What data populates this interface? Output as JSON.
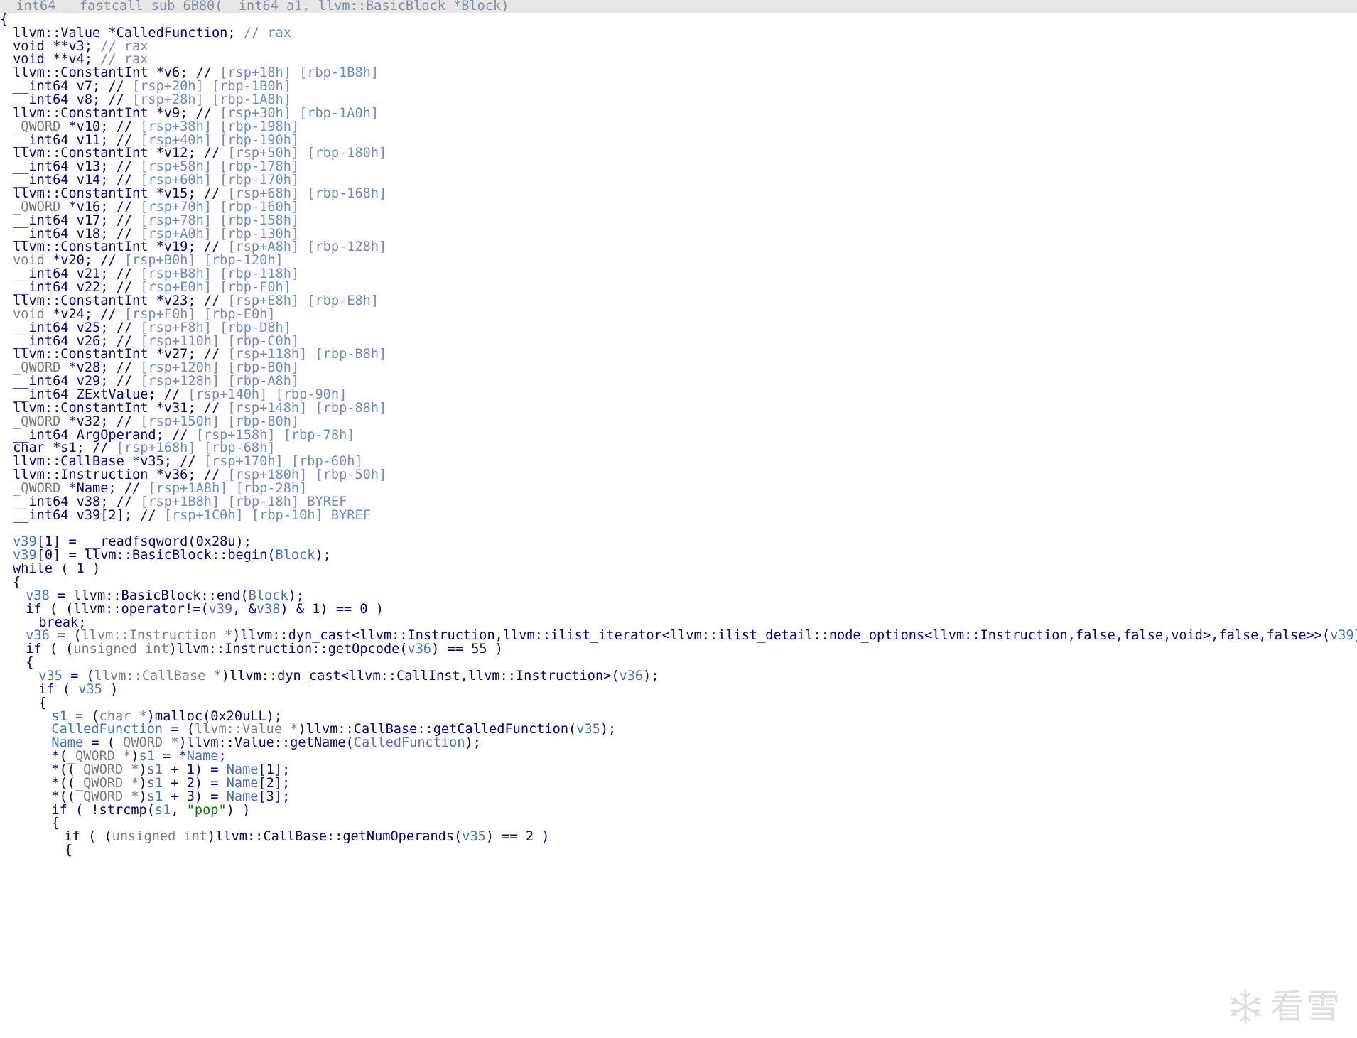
{
  "colors": {
    "background": "#ffffff",
    "header_bar": "#e6e6e6",
    "code": "#000080",
    "variable": "#4a6fbf",
    "type": "#7a7a7a",
    "comment": "#6f88c8",
    "string": "#007a00"
  },
  "watermark": {
    "logo_icon": "snowflake-icon",
    "text": "看雪"
  },
  "lines": [
    {
      "indent": 0,
      "header": true,
      "tokens": [
        {
          "t": "__int64 __fastcall sub_6B80(__int64 a1, llvm::BasicBlock *Block)",
          "c": "g"
        }
      ]
    },
    {
      "indent": 0,
      "tokens": [
        {
          "t": "{",
          "c": "c"
        }
      ]
    },
    {
      "indent": 1,
      "tokens": [
        {
          "t": "llvm::Value *CalledFunction; ",
          "c": "c"
        },
        {
          "t": "// rax",
          "c": "cm"
        }
      ]
    },
    {
      "indent": 1,
      "tokens": [
        {
          "t": "void **v3; ",
          "c": "c"
        },
        {
          "t": "// rax",
          "c": "cm"
        }
      ]
    },
    {
      "indent": 1,
      "tokens": [
        {
          "t": "void **v4; ",
          "c": "c"
        },
        {
          "t": "// rax",
          "c": "cm"
        }
      ]
    },
    {
      "indent": 1,
      "tokens": [
        {
          "t": "llvm::ConstantInt *v6; // ",
          "c": "c"
        },
        {
          "t": "[rsp+18h] [rbp-1B8h]",
          "c": "cm"
        }
      ]
    },
    {
      "indent": 1,
      "tokens": [
        {
          "t": "__int64 v7; // ",
          "c": "c"
        },
        {
          "t": "[rsp+20h] [rbp-1B0h]",
          "c": "cm"
        }
      ]
    },
    {
      "indent": 1,
      "tokens": [
        {
          "t": "__int64 v8; // ",
          "c": "c"
        },
        {
          "t": "[rsp+28h] [rbp-1A8h]",
          "c": "cm"
        }
      ]
    },
    {
      "indent": 1,
      "tokens": [
        {
          "t": "llvm::ConstantInt *v9; // ",
          "c": "c"
        },
        {
          "t": "[rsp+30h] [rbp-1A0h]",
          "c": "cm"
        }
      ]
    },
    {
      "indent": 1,
      "tokens": [
        {
          "t": "_QWORD",
          "c": "t"
        },
        {
          "t": " *v10; // ",
          "c": "c"
        },
        {
          "t": "[rsp+38h] [rbp-198h]",
          "c": "cm"
        }
      ]
    },
    {
      "indent": 1,
      "tokens": [
        {
          "t": "__int64 v11; // ",
          "c": "c"
        },
        {
          "t": "[rsp+40h] [rbp-190h]",
          "c": "cm"
        }
      ]
    },
    {
      "indent": 1,
      "tokens": [
        {
          "t": "llvm::ConstantInt *v12; // ",
          "c": "c"
        },
        {
          "t": "[rsp+50h] [rbp-180h]",
          "c": "cm"
        }
      ]
    },
    {
      "indent": 1,
      "tokens": [
        {
          "t": "__int64 v13; // ",
          "c": "c"
        },
        {
          "t": "[rsp+58h] [rbp-178h]",
          "c": "cm"
        }
      ]
    },
    {
      "indent": 1,
      "tokens": [
        {
          "t": "__int64 v14; // ",
          "c": "c"
        },
        {
          "t": "[rsp+60h] [rbp-170h]",
          "c": "cm"
        }
      ]
    },
    {
      "indent": 1,
      "tokens": [
        {
          "t": "llvm::ConstantInt *v15; // ",
          "c": "c"
        },
        {
          "t": "[rsp+68h] [rbp-168h]",
          "c": "cm"
        }
      ]
    },
    {
      "indent": 1,
      "tokens": [
        {
          "t": "_QWORD",
          "c": "t"
        },
        {
          "t": " *v16; // ",
          "c": "c"
        },
        {
          "t": "[rsp+70h] [rbp-160h]",
          "c": "cm"
        }
      ]
    },
    {
      "indent": 1,
      "tokens": [
        {
          "t": "__int64 v17; // ",
          "c": "c"
        },
        {
          "t": "[rsp+78h] [rbp-158h]",
          "c": "cm"
        }
      ]
    },
    {
      "indent": 1,
      "tokens": [
        {
          "t": "__int64 v18; // ",
          "c": "c"
        },
        {
          "t": "[rsp+A0h] [rbp-130h]",
          "c": "cm"
        }
      ]
    },
    {
      "indent": 1,
      "tokens": [
        {
          "t": "llvm::ConstantInt *v19; // ",
          "c": "c"
        },
        {
          "t": "[rsp+A8h] [rbp-128h]",
          "c": "cm"
        }
      ]
    },
    {
      "indent": 1,
      "tokens": [
        {
          "t": "void",
          "c": "t"
        },
        {
          "t": " *v20; // ",
          "c": "c"
        },
        {
          "t": "[rsp+B0h] [rbp-120h]",
          "c": "cm"
        }
      ]
    },
    {
      "indent": 1,
      "tokens": [
        {
          "t": "__int64 v21; // ",
          "c": "c"
        },
        {
          "t": "[rsp+B8h] [rbp-118h]",
          "c": "cm"
        }
      ]
    },
    {
      "indent": 1,
      "tokens": [
        {
          "t": "__int64 v22; // ",
          "c": "c"
        },
        {
          "t": "[rsp+E0h] [rbp-F0h]",
          "c": "cm"
        }
      ]
    },
    {
      "indent": 1,
      "tokens": [
        {
          "t": "llvm::ConstantInt *v23; // ",
          "c": "c"
        },
        {
          "t": "[rsp+E8h] [rbp-E8h]",
          "c": "cm"
        }
      ]
    },
    {
      "indent": 1,
      "tokens": [
        {
          "t": "void",
          "c": "t"
        },
        {
          "t": " *v24; // ",
          "c": "c"
        },
        {
          "t": "[rsp+F0h] [rbp-E0h]",
          "c": "cm"
        }
      ]
    },
    {
      "indent": 1,
      "tokens": [
        {
          "t": "__int64 v25; // ",
          "c": "c"
        },
        {
          "t": "[rsp+F8h] [rbp-D8h]",
          "c": "cm"
        }
      ]
    },
    {
      "indent": 1,
      "tokens": [
        {
          "t": "__int64 v26; // ",
          "c": "c"
        },
        {
          "t": "[rsp+110h] [rbp-C0h]",
          "c": "cm"
        }
      ]
    },
    {
      "indent": 1,
      "tokens": [
        {
          "t": "llvm::ConstantInt *v27; // ",
          "c": "c"
        },
        {
          "t": "[rsp+118h] [rbp-B8h]",
          "c": "cm"
        }
      ]
    },
    {
      "indent": 1,
      "tokens": [
        {
          "t": "_QWORD",
          "c": "t"
        },
        {
          "t": " *v28; // ",
          "c": "c"
        },
        {
          "t": "[rsp+120h] [rbp-B0h]",
          "c": "cm"
        }
      ]
    },
    {
      "indent": 1,
      "tokens": [
        {
          "t": "__int64 v29; // ",
          "c": "c"
        },
        {
          "t": "[rsp+128h] [rbp-A8h]",
          "c": "cm"
        }
      ]
    },
    {
      "indent": 1,
      "tokens": [
        {
          "t": "__int64 ZExtValue; // ",
          "c": "c"
        },
        {
          "t": "[rsp+140h] [rbp-90h]",
          "c": "cm"
        }
      ]
    },
    {
      "indent": 1,
      "tokens": [
        {
          "t": "llvm::ConstantInt *v31; // ",
          "c": "c"
        },
        {
          "t": "[rsp+148h] [rbp-88h]",
          "c": "cm"
        }
      ]
    },
    {
      "indent": 1,
      "tokens": [
        {
          "t": "_QWORD",
          "c": "t"
        },
        {
          "t": " *v32; // ",
          "c": "c"
        },
        {
          "t": "[rsp+150h] [rbp-80h]",
          "c": "cm"
        }
      ]
    },
    {
      "indent": 1,
      "tokens": [
        {
          "t": "__int64 ArgOperand; // ",
          "c": "c"
        },
        {
          "t": "[rsp+158h] [rbp-78h]",
          "c": "cm"
        }
      ]
    },
    {
      "indent": 1,
      "tokens": [
        {
          "t": "char *s1; // ",
          "c": "c"
        },
        {
          "t": "[rsp+168h] [rbp-68h]",
          "c": "cm"
        }
      ]
    },
    {
      "indent": 1,
      "tokens": [
        {
          "t": "llvm::CallBase *v35; // ",
          "c": "c"
        },
        {
          "t": "[rsp+170h] [rbp-60h]",
          "c": "cm"
        }
      ]
    },
    {
      "indent": 1,
      "tokens": [
        {
          "t": "llvm::Instruction *v36; // ",
          "c": "c"
        },
        {
          "t": "[rsp+180h] [rbp-50h]",
          "c": "cm"
        }
      ]
    },
    {
      "indent": 1,
      "tokens": [
        {
          "t": "_QWORD",
          "c": "t"
        },
        {
          "t": " *Name; // ",
          "c": "c"
        },
        {
          "t": "[rsp+1A8h] [rbp-28h]",
          "c": "cm"
        }
      ]
    },
    {
      "indent": 1,
      "tokens": [
        {
          "t": "__int64 v38; // ",
          "c": "c"
        },
        {
          "t": "[rsp+1B8h] [rbp-18h] BYREF",
          "c": "cm"
        }
      ]
    },
    {
      "indent": 1,
      "tokens": [
        {
          "t": "__int64 v39[2]; // ",
          "c": "c"
        },
        {
          "t": "[rsp+1C0h] [rbp-10h] BYREF",
          "c": "cm"
        }
      ]
    },
    {
      "indent": 0,
      "tokens": []
    },
    {
      "indent": 1,
      "tokens": [
        {
          "t": "v39",
          "c": "v"
        },
        {
          "t": "[1] = __readfsqword(0x28u);",
          "c": "c"
        }
      ]
    },
    {
      "indent": 1,
      "tokens": [
        {
          "t": "v39",
          "c": "v"
        },
        {
          "t": "[0] = llvm::BasicBlock::begin(",
          "c": "c"
        },
        {
          "t": "Block",
          "c": "v"
        },
        {
          "t": ");",
          "c": "c"
        }
      ]
    },
    {
      "indent": 1,
      "tokens": [
        {
          "t": "while ( 1 )",
          "c": "c"
        }
      ]
    },
    {
      "indent": 1,
      "tokens": [
        {
          "t": "{",
          "c": "c"
        }
      ]
    },
    {
      "indent": 2,
      "tokens": [
        {
          "t": "v38",
          "c": "v"
        },
        {
          "t": " = llvm::BasicBlock::end(",
          "c": "c"
        },
        {
          "t": "Block",
          "c": "v"
        },
        {
          "t": ");",
          "c": "c"
        }
      ]
    },
    {
      "indent": 2,
      "tokens": [
        {
          "t": "if ( (llvm::operator!=(",
          "c": "c"
        },
        {
          "t": "v39",
          "c": "v"
        },
        {
          "t": ", &",
          "c": "c"
        },
        {
          "t": "v38",
          "c": "v"
        },
        {
          "t": ") & 1) == 0 )",
          "c": "c"
        }
      ]
    },
    {
      "indent": 3,
      "tokens": [
        {
          "t": "break;",
          "c": "c"
        }
      ]
    },
    {
      "indent": 2,
      "tokens": [
        {
          "t": "v36",
          "c": "v"
        },
        {
          "t": " = (",
          "c": "c"
        },
        {
          "t": "llvm::Instruction *",
          "c": "t"
        },
        {
          "t": ")llvm::dyn_cast<llvm::Instruction,llvm::ilist_iterator<llvm::ilist_detail::node_options<llvm::Instruction,false,false,void>,false,false>>(",
          "c": "c"
        },
        {
          "t": "v39",
          "c": "v"
        },
        {
          "t": ");",
          "c": "c"
        }
      ]
    },
    {
      "indent": 2,
      "tokens": [
        {
          "t": "if ( (",
          "c": "c"
        },
        {
          "t": "unsigned int",
          "c": "t"
        },
        {
          "t": ")llvm::Instruction::getOpcode(",
          "c": "c"
        },
        {
          "t": "v36",
          "c": "v"
        },
        {
          "t": ") == 55 )",
          "c": "c"
        }
      ]
    },
    {
      "indent": 2,
      "tokens": [
        {
          "t": "{",
          "c": "c"
        }
      ]
    },
    {
      "indent": 3,
      "tokens": [
        {
          "t": "v35",
          "c": "v"
        },
        {
          "t": " = (",
          "c": "c"
        },
        {
          "t": "llvm::CallBase *",
          "c": "t"
        },
        {
          "t": ")llvm::dyn_cast<llvm::CallInst,llvm::Instruction>(",
          "c": "c"
        },
        {
          "t": "v36",
          "c": "v"
        },
        {
          "t": ");",
          "c": "c"
        }
      ]
    },
    {
      "indent": 3,
      "tokens": [
        {
          "t": "if ( ",
          "c": "c"
        },
        {
          "t": "v35",
          "c": "v"
        },
        {
          "t": " )",
          "c": "c"
        }
      ]
    },
    {
      "indent": 3,
      "tokens": [
        {
          "t": "{",
          "c": "c"
        }
      ]
    },
    {
      "indent": 4,
      "tokens": [
        {
          "t": "s1",
          "c": "v"
        },
        {
          "t": " = (",
          "c": "c"
        },
        {
          "t": "char *",
          "c": "t"
        },
        {
          "t": ")malloc(0x20uLL);",
          "c": "c"
        }
      ]
    },
    {
      "indent": 4,
      "tokens": [
        {
          "t": "CalledFunction",
          "c": "v"
        },
        {
          "t": " = (",
          "c": "c"
        },
        {
          "t": "llvm::Value *",
          "c": "t"
        },
        {
          "t": ")llvm::CallBase::getCalledFunction(",
          "c": "c"
        },
        {
          "t": "v35",
          "c": "v"
        },
        {
          "t": ");",
          "c": "c"
        }
      ]
    },
    {
      "indent": 4,
      "tokens": [
        {
          "t": "Name",
          "c": "v"
        },
        {
          "t": " = (",
          "c": "c"
        },
        {
          "t": "_QWORD *",
          "c": "t"
        },
        {
          "t": ")llvm::Value::getName(",
          "c": "c"
        },
        {
          "t": "CalledFunction",
          "c": "v"
        },
        {
          "t": ");",
          "c": "c"
        }
      ]
    },
    {
      "indent": 4,
      "tokens": [
        {
          "t": "*(",
          "c": "c"
        },
        {
          "t": "_QWORD *",
          "c": "t"
        },
        {
          "t": ")",
          "c": "c"
        },
        {
          "t": "s1",
          "c": "v"
        },
        {
          "t": " = *",
          "c": "c"
        },
        {
          "t": "Name",
          "c": "v"
        },
        {
          "t": ";",
          "c": "c"
        }
      ]
    },
    {
      "indent": 4,
      "tokens": [
        {
          "t": "*((",
          "c": "c"
        },
        {
          "t": "_QWORD *",
          "c": "t"
        },
        {
          "t": ")",
          "c": "c"
        },
        {
          "t": "s1",
          "c": "v"
        },
        {
          "t": " + 1) = ",
          "c": "c"
        },
        {
          "t": "Name",
          "c": "v"
        },
        {
          "t": "[1];",
          "c": "c"
        }
      ]
    },
    {
      "indent": 4,
      "tokens": [
        {
          "t": "*((",
          "c": "c"
        },
        {
          "t": "_QWORD *",
          "c": "t"
        },
        {
          "t": ")",
          "c": "c"
        },
        {
          "t": "s1",
          "c": "v"
        },
        {
          "t": " + 2) = ",
          "c": "c"
        },
        {
          "t": "Name",
          "c": "v"
        },
        {
          "t": "[2];",
          "c": "c"
        }
      ]
    },
    {
      "indent": 4,
      "tokens": [
        {
          "t": "*((",
          "c": "c"
        },
        {
          "t": "_QWORD *",
          "c": "t"
        },
        {
          "t": ")",
          "c": "c"
        },
        {
          "t": "s1",
          "c": "v"
        },
        {
          "t": " + 3) = ",
          "c": "c"
        },
        {
          "t": "Name",
          "c": "v"
        },
        {
          "t": "[3];",
          "c": "c"
        }
      ]
    },
    {
      "indent": 4,
      "tokens": [
        {
          "t": "if ( !strcmp(",
          "c": "c"
        },
        {
          "t": "s1",
          "c": "v"
        },
        {
          "t": ", ",
          "c": "c"
        },
        {
          "t": "\"pop\"",
          "c": "s"
        },
        {
          "t": ") )",
          "c": "c"
        }
      ]
    },
    {
      "indent": 4,
      "tokens": [
        {
          "t": "{",
          "c": "c"
        }
      ]
    },
    {
      "indent": 5,
      "tokens": [
        {
          "t": "if ( (",
          "c": "c"
        },
        {
          "t": "unsigned int",
          "c": "t"
        },
        {
          "t": ")llvm::CallBase::getNumOperands(",
          "c": "c"
        },
        {
          "t": "v35",
          "c": "v"
        },
        {
          "t": ") == 2 )",
          "c": "c"
        }
      ]
    },
    {
      "indent": 5,
      "tokens": [
        {
          "t": "{",
          "c": "c"
        }
      ]
    }
  ]
}
